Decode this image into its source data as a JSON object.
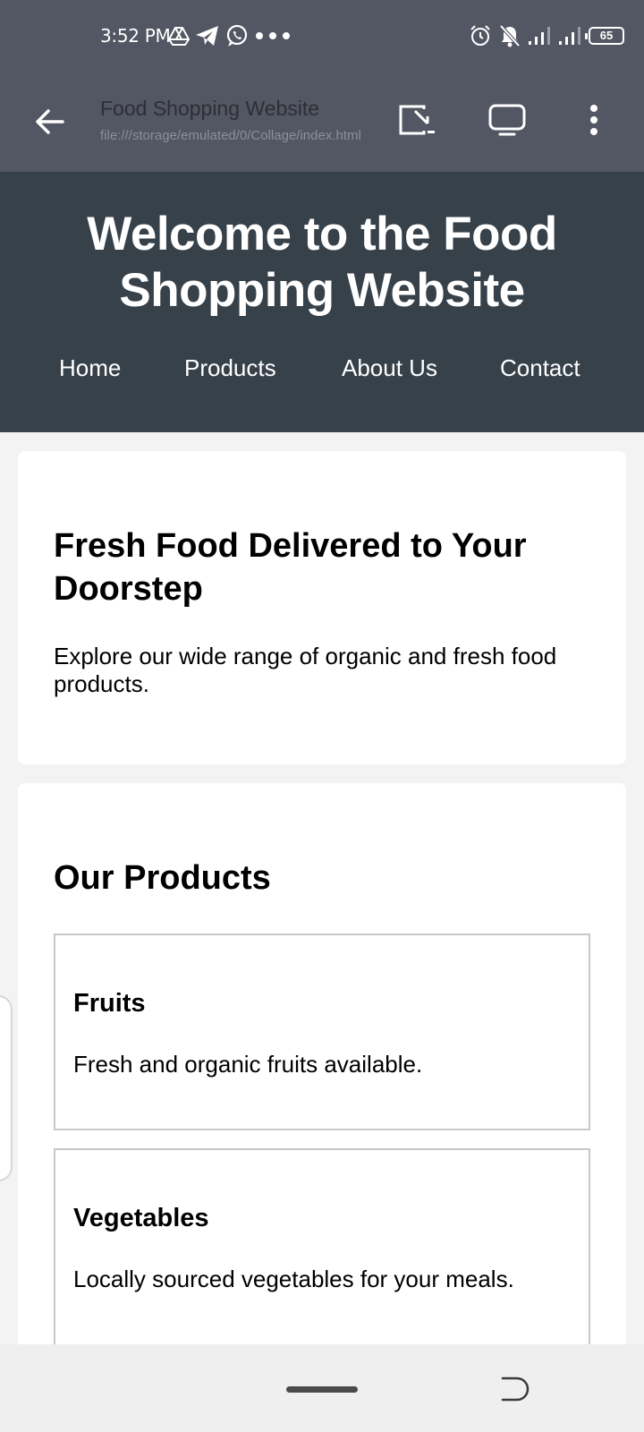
{
  "status_bar": {
    "time": "3:52 PM",
    "left_icons": [
      "drive-icon",
      "telegram-icon",
      "whatsapp-icon",
      "more-dots-icon"
    ],
    "right_icons": [
      "alarm-icon",
      "bell-off-icon",
      "signal-icon",
      "signal-icon"
    ],
    "battery": "65"
  },
  "toolbar": {
    "title": "Food Shopping Website",
    "url": "file:///storage/emulated/0/Collage/index.html"
  },
  "page": {
    "header_title": "Welcome to the Food Shopping Website",
    "nav": [
      "Home",
      "Products",
      "About Us",
      "Contact"
    ],
    "hero": {
      "heading": "Fresh Food Delivered to Your Doorstep",
      "text": "Explore our wide range of organic and fresh food products."
    },
    "products": {
      "heading": "Our Products",
      "items": [
        {
          "name": "Fruits",
          "description": "Fresh and organic fruits available."
        },
        {
          "name": "Vegetables",
          "description": "Locally sourced vegetables for your meals."
        }
      ]
    }
  },
  "colors": {
    "status_bar": "#535663",
    "page_header": "#37414a",
    "background": "#f3f3f3",
    "card": "#ffffff"
  }
}
